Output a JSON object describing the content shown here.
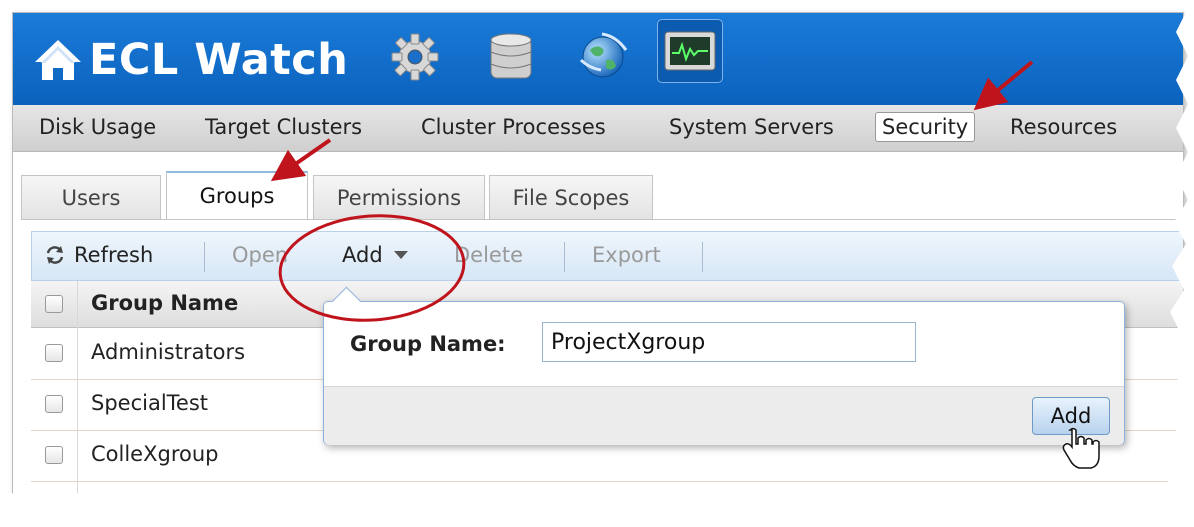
{
  "app": {
    "title": "ECL Watch",
    "header_icons": [
      "gear-icon",
      "database-icon",
      "globe-icon",
      "monitor-icon"
    ]
  },
  "nav": {
    "items": [
      "Disk Usage",
      "Target Clusters",
      "Cluster Processes",
      "System Servers",
      "Security",
      "Resources"
    ],
    "selected": "Security"
  },
  "tabs": {
    "items": [
      "Users",
      "Groups",
      "Permissions",
      "File Scopes"
    ],
    "selected": "Groups"
  },
  "toolbar": {
    "refresh": "Refresh",
    "open": "Open",
    "add": "Add",
    "delete": "Delete",
    "export": "Export"
  },
  "grid": {
    "column": "Group Name",
    "rows": [
      "Administrators",
      "SpecialTest",
      "ColleXgroup"
    ]
  },
  "popup": {
    "label": "Group Name:",
    "value": "ProjectXgroup",
    "button": "Add"
  },
  "colors": {
    "header_blue": "#0c6ac6",
    "annotation_red": "#c0141c"
  }
}
